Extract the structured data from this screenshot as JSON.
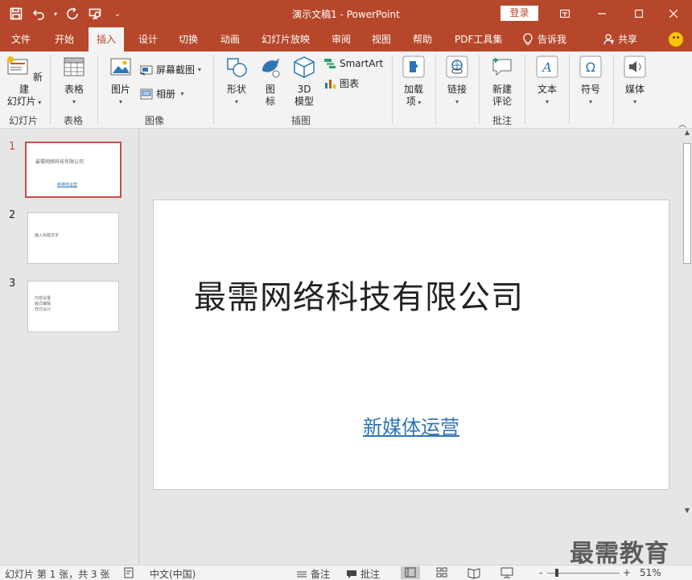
{
  "titlebar": {
    "doc_title": "演示文稿1  -  PowerPoint",
    "login": "登录"
  },
  "tabs": [
    {
      "label": "文件"
    },
    {
      "label": "开始"
    },
    {
      "label": "插入"
    },
    {
      "label": "设计"
    },
    {
      "label": "切换"
    },
    {
      "label": "动画"
    },
    {
      "label": "幻灯片放映"
    },
    {
      "label": "审阅"
    },
    {
      "label": "视图"
    },
    {
      "label": "帮助"
    },
    {
      "label": "PDF工具集"
    }
  ],
  "tell_me": "告诉我",
  "share": "共享",
  "ribbon": {
    "new_slide": "新建",
    "new_slide2": "幻灯片",
    "table": "表格",
    "picture": "图片",
    "screenshot": "屏幕截图",
    "album": "相册",
    "shapes": "形状",
    "icons1": "图",
    "icons2": "标",
    "model1": "3D",
    "model2": "模型",
    "smartart": "SmartArt",
    "chart": "图表",
    "addins1": "加载",
    "addins2": "项",
    "link": "链接",
    "comment1": "新建",
    "comment2": "评论",
    "text": "文本",
    "symbol": "符号",
    "media": "媒体",
    "groups": {
      "slides": "幻灯片",
      "tables": "表格",
      "images": "图像",
      "illustrations": "插图",
      "comments": "批注"
    }
  },
  "thumbnails": [
    {
      "num": "1",
      "title": "最需网络科技有限公司",
      "sub": "新媒体运营"
    },
    {
      "num": "2",
      "title": "输入标题文字"
    },
    {
      "num": "3",
      "line1": "内容设置",
      "line2": "版式编辑",
      "line3": "样式设计"
    }
  ],
  "slide": {
    "title": "最需网络科技有限公司",
    "subtitle": "新媒体运营"
  },
  "watermark": "最需教育",
  "status": {
    "slide_info": "幻灯片 第 1 张，共 3 张",
    "language": "中文(中国)",
    "notes": "备注",
    "comments": "批注",
    "zoom": "51%",
    "minus": "-",
    "plus": "+"
  }
}
